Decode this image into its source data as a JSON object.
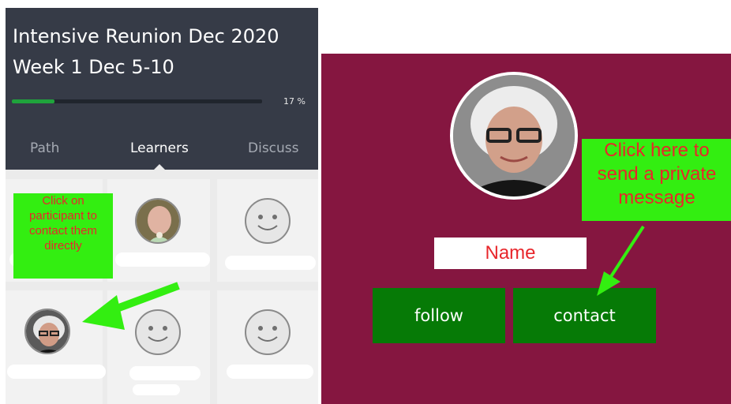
{
  "course": {
    "title_line1": "Intensive Reunion Dec 2020",
    "title_line2": "Week 1 Dec 5-10",
    "progress_label": "17 %",
    "progress": 0.17
  },
  "tabs": [
    {
      "label": "Path",
      "active": false
    },
    {
      "label": "Learners",
      "active": true
    },
    {
      "label": "Discuss",
      "active": false
    }
  ],
  "annotations": {
    "left_callout": "Click on participant to contact them directly",
    "right_callout": "Click here to send a private message",
    "name_label": "Name"
  },
  "profile": {
    "follow_label": "follow",
    "contact_label": "contact"
  },
  "colors": {
    "header": "#363b47",
    "progress": "#1fa33c",
    "profile_bg": "#851640",
    "button": "#067a06",
    "callout_bg": "#33ee11",
    "callout_text": "#e8262b"
  }
}
